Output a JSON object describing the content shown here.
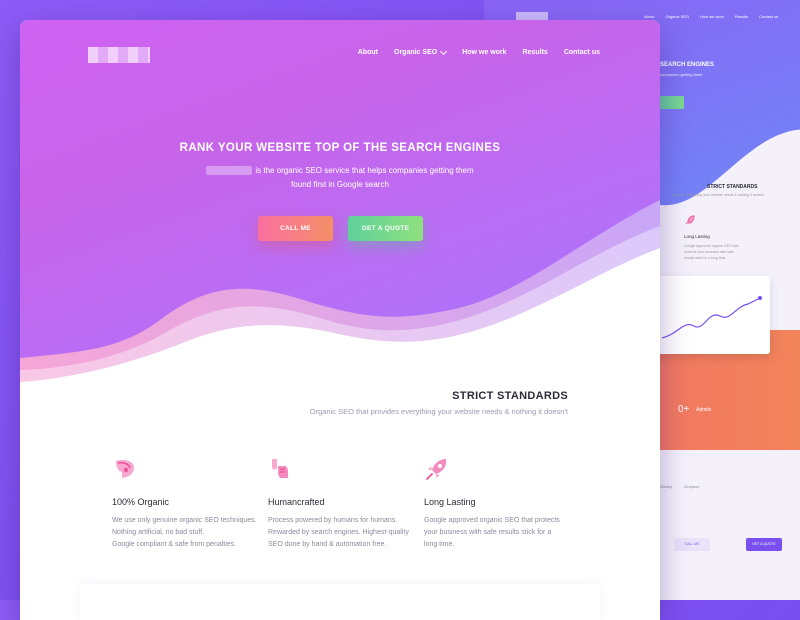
{
  "nav": {
    "items": [
      "About",
      "Organic SEO",
      "How we work",
      "Results",
      "Contact us"
    ]
  },
  "hero": {
    "title": "RANK YOUR WEBSITE TOP OF THE SEARCH ENGINES",
    "subtitle_line1": "is the organic SEO service that helps companies getting them",
    "subtitle_line2": "found first in Google search",
    "call_button": "CALL ME",
    "quote_button": "GET A QUOTE"
  },
  "standards": {
    "title": "STRICT STANDARDS",
    "subtitle": "Organic SEO that provides everything your website needs & nothing it doesn't"
  },
  "features": [
    {
      "title": "100% Organic",
      "icon": "organic-icon",
      "desc": [
        "We use only genuine organic SEO techniques.",
        "Nothing artificial, no bad stuff.",
        "Google compliant & safe from penalties."
      ]
    },
    {
      "title": "Humancrafted",
      "icon": "humancrafted-icon",
      "desc": [
        "Process powered by humans for humans.",
        "Rewarded by search engines. Highest-quality",
        "SEO done by hand & automation free."
      ]
    },
    {
      "title": "Long Lasting",
      "icon": "rocket-icon",
      "desc": [
        "Google approved organic SEO that protects",
        "your business with safe results stick for a",
        "long time."
      ]
    }
  ],
  "bg_page": {
    "nav": [
      "About",
      "Organic SEO",
      "How we work",
      "Results",
      "Contact us"
    ],
    "hero_title": "SEARCH ENGINES",
    "hero_sub": "companies getting them",
    "strict": "STRICT STANDARDS",
    "strict_sub": "provides everything your website needs & nothing it doesn't",
    "long_title": "Long Lasting",
    "long_desc": "Google approved organic SEO that protects your business with safe results stick for a long time.",
    "admits_num": "0+",
    "admits_label": "Admits",
    "brands": [
      "Disney",
      "Dropbox"
    ],
    "call": "CALL ME",
    "quote": "GET A QUOTE"
  },
  "colors": {
    "accent_purple": "#7a4ff0",
    "call_gradient": [
      "#fb6fa1",
      "#f49066"
    ],
    "quote_gradient": [
      "#5fd19b",
      "#8fe07e"
    ]
  }
}
